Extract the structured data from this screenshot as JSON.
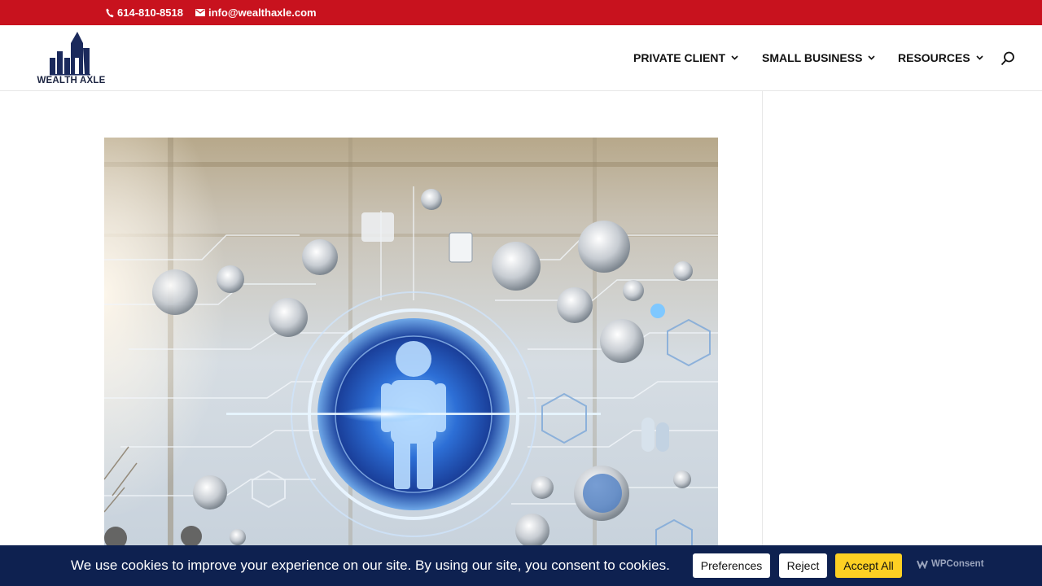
{
  "topbar": {
    "phone": "614-810-8518",
    "email": "info@wealthaxle.com",
    "background": "#c8121e"
  },
  "header": {
    "logo_text": "WEALTH AXLE",
    "nav": [
      {
        "label": "PRIVATE CLIENT",
        "icon": "chevron-down-icon"
      },
      {
        "label": "SMALL BUSINESS",
        "icon": "chevron-down-icon"
      },
      {
        "label": "RESOURCES",
        "icon": "chevron-down-icon"
      }
    ],
    "search_icon": "search-icon"
  },
  "cookie_banner": {
    "message": "We use cookies to improve your experience on our site. By using our site, you consent to cookies.",
    "preferences_label": "Preferences",
    "reject_label": "Reject",
    "accept_label": "Accept All",
    "brand": "WPConsent",
    "background": "#0e2150",
    "accept_color": "#fdd023"
  }
}
